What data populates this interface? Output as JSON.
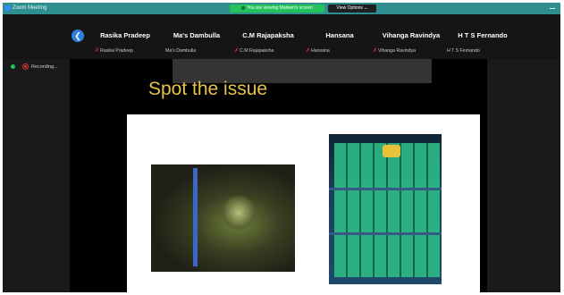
{
  "window": {
    "title": "Zoom Meeting",
    "share_notice": "You are viewing Malwen's screen",
    "view_options": "View Options ⌄"
  },
  "participants": [
    {
      "name": "Rasika Pradeep",
      "label": "Rasika Pradeep",
      "muted": true
    },
    {
      "name": "Ma's Dambulla",
      "label": "Ma's Dambulla",
      "muted": false
    },
    {
      "name": "C.M Rajapaksha",
      "label": "C.M Rajapaksha",
      "muted": true
    },
    {
      "name": "Hansana",
      "label": "Hansana",
      "muted": true
    },
    {
      "name": "Vihanga Ravindya",
      "label": "Vihanga Ravindya",
      "muted": true
    },
    {
      "name": "H T S Fernando",
      "label": "H T S Fernando",
      "muted": false
    }
  ],
  "recording": {
    "label": "Recording..."
  },
  "slide": {
    "title": "Spot the issue"
  },
  "icons": {
    "nav": "chevron-left-icon",
    "mic": "mic-muted-icon"
  },
  "colors": {
    "titlebar": "#2f8f8f",
    "share_pill": "#23c25a",
    "slide_title": "#e8c34a",
    "nav_button": "#2d7fe0"
  }
}
